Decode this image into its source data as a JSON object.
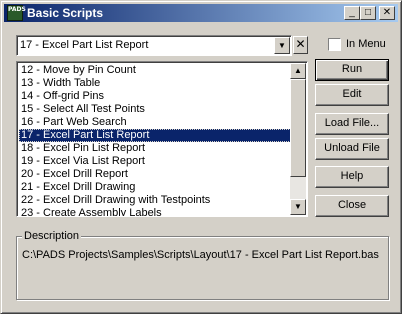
{
  "window": {
    "title": "Basic Scripts",
    "icon_text": "PADS",
    "minimize_glyph": "_",
    "maximize_glyph": "□",
    "close_glyph": "✕"
  },
  "script_select": {
    "value": "17 - Excel Part List Report",
    "arrow": "▼",
    "clear_glyph": "✕"
  },
  "in_menu": {
    "label": "In Menu",
    "checked": false
  },
  "script_list": {
    "items": [
      "12 - Move by Pin Count",
      "13 - Width Table",
      "14 - Off-grid Pins",
      "15 - Select All Test Points",
      "16 - Part Web Search",
      "17 - Excel Part List Report",
      "18 - Excel Pin List Report",
      "19 - Excel Via List Report",
      "20 - Excel Drill Report",
      "21 - Excel Drill Drawing",
      "22 - Excel Drill Drawing with Testpoints",
      "23 - Create Assembly Labels"
    ],
    "selected_index": 5,
    "scroll_up": "▲",
    "scroll_down": "▼"
  },
  "buttons": {
    "run": {
      "mnemonic": "R",
      "rest": "un"
    },
    "edit": {
      "mnemonic": "E",
      "rest": "dit"
    },
    "load": {
      "mnemonic": "L",
      "rest": "oad File..."
    },
    "unload": {
      "mnemonic": "U",
      "rest": "nload File"
    },
    "help": {
      "mnemonic": "H",
      "rest": "elp"
    },
    "close": {
      "label": "Close"
    }
  },
  "description": {
    "title": "Description",
    "text": "C:\\PADS Projects\\Samples\\Scripts\\Layout\\17 - Excel Part List Report.bas"
  }
}
